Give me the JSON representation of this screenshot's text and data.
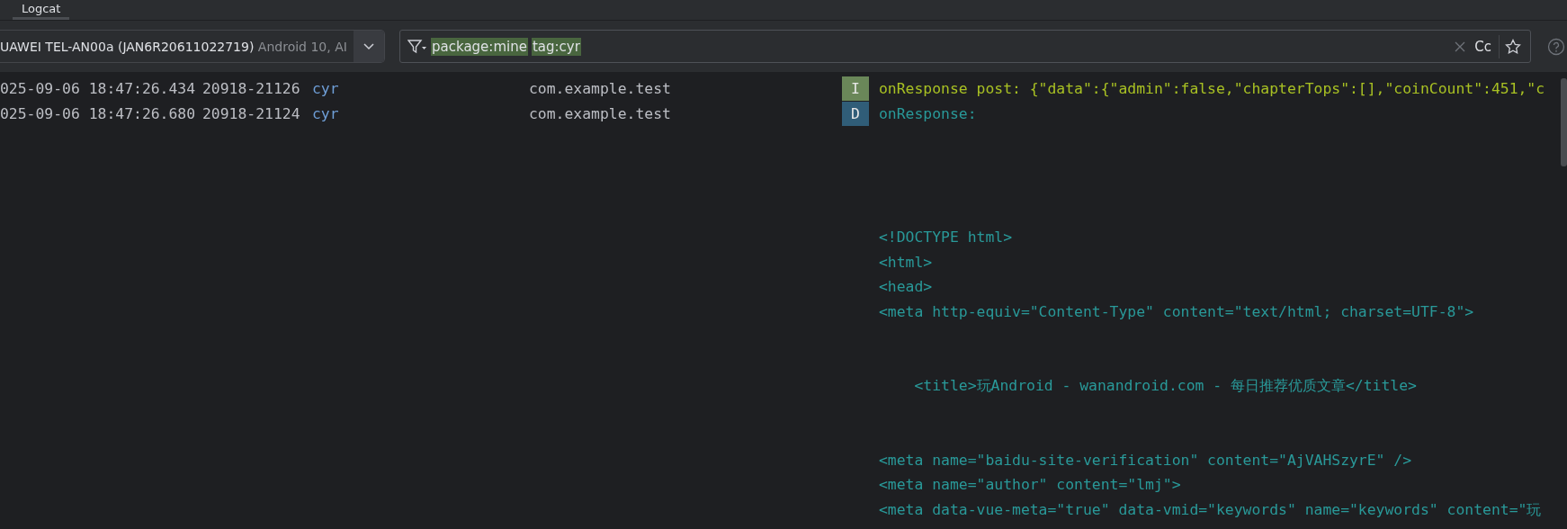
{
  "tabs": [
    {
      "label": "Logcat",
      "selected": true
    }
  ],
  "device_selector": {
    "device": "UAWEI TEL-AN00a (JAN6R20611022719)",
    "detail": "Android 10, AI"
  },
  "filter": {
    "terms": [
      "package:mine",
      "tag:cyr"
    ]
  },
  "case_toggle": {
    "label": "Cc",
    "on": false
  },
  "log_rows": [
    {
      "timestamp": "025-09-06 18:47:26.434",
      "pid": "20918-21126",
      "tag": "cyr",
      "package": "com.example.test",
      "level": "I",
      "kind": "info",
      "message": "onResponse post: {\"data\":{\"admin\":false,\"chapterTops\":[],\"coinCount\":451,\"c"
    },
    {
      "timestamp": "025-09-06 18:47:26.680",
      "pid": "20918-21124",
      "tag": "cyr",
      "package": "com.example.test",
      "level": "D",
      "kind": "debug",
      "message": "onResponse:\n\n\n\n\n<!DOCTYPE html>\n<html>\n<head>\n<meta http-equiv=\"Content-Type\" content=\"text/html; charset=UTF-8\">\n\n\n    <title>玩Android - wanandroid.com - 每日推荐优质文章</title>\n\n\n<meta name=\"baidu-site-verification\" content=\"AjVAHSzyrE\" />\n<meta name=\"author\" content=\"lmj\">\n<meta data-vue-meta=\"true\" data-vmid=\"keywords\" name=\"keywords\" content=\"玩"
    }
  ]
}
